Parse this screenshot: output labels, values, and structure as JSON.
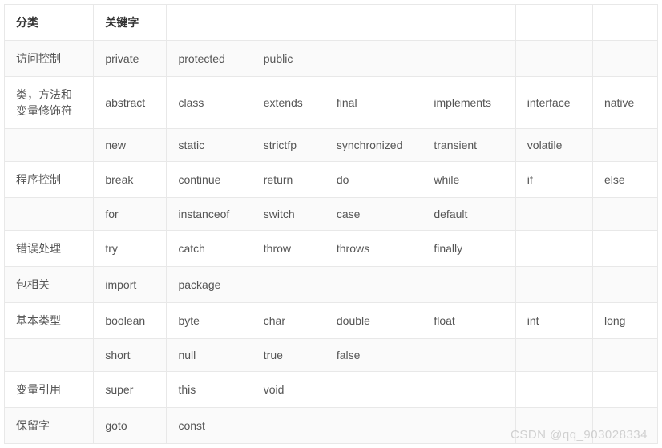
{
  "chart_data": {
    "type": "table",
    "headers": [
      "分类",
      "关键字",
      "",
      "",
      "",
      "",
      "",
      ""
    ],
    "rows": [
      [
        "访问控制",
        "private",
        "protected",
        "public",
        "",
        "",
        "",
        ""
      ],
      [
        "类，方法和变量修饰符",
        "abstract",
        "class",
        "extends",
        "final",
        "implements",
        "interface",
        "native"
      ],
      [
        "",
        "new",
        "static",
        "strictfp",
        "synchronized",
        "transient",
        "volatile",
        ""
      ],
      [
        "程序控制",
        "break",
        "continue",
        "return",
        "do",
        "while",
        "if",
        "else"
      ],
      [
        "",
        "for",
        "instanceof",
        "switch",
        "case",
        "default",
        "",
        ""
      ],
      [
        "错误处理",
        "try",
        "catch",
        "throw",
        "throws",
        "finally",
        "",
        ""
      ],
      [
        "包相关",
        "import",
        "package",
        "",
        "",
        "",
        "",
        ""
      ],
      [
        "基本类型",
        "boolean",
        "byte",
        "char",
        "double",
        "float",
        "int",
        "long"
      ],
      [
        "",
        "short",
        "null",
        "true",
        "false",
        "",
        "",
        ""
      ],
      [
        "变量引用",
        "super",
        "this",
        "void",
        "",
        "",
        "",
        ""
      ],
      [
        "保留字",
        "goto",
        "const",
        "",
        "",
        "",
        "",
        ""
      ]
    ]
  },
  "watermark": "CSDN @qq_903028334"
}
